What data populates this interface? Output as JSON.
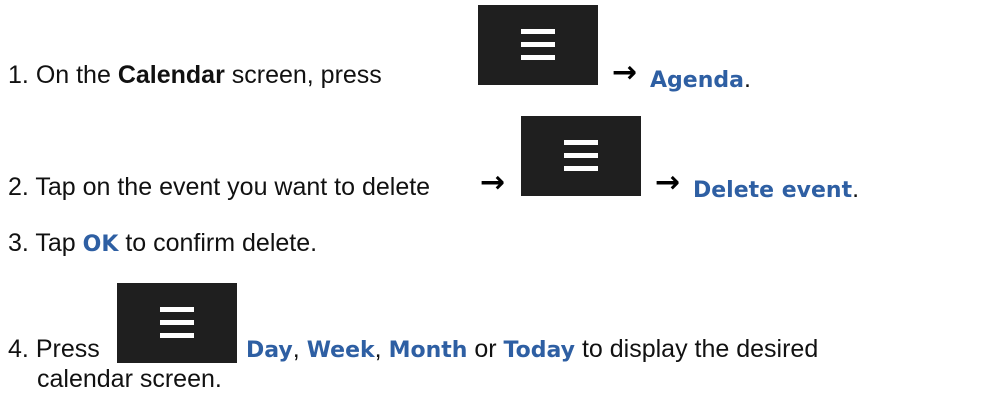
{
  "steps": [
    {
      "number": "1.",
      "prefix": "On the ",
      "bold": "Calendar",
      "middle": " screen, press",
      "arrow": "→",
      "keyword": "Agenda",
      "suffix": "."
    },
    {
      "number": "2.",
      "prefix": "Tap on the event you want to delete",
      "arrow_a": "→",
      "arrow_b": "→",
      "keyword": "Delete event",
      "suffix": "."
    },
    {
      "number": "3.",
      "prefix": "Tap ",
      "keyword": "OK",
      "suffix": " to confirm delete."
    },
    {
      "number": "4.",
      "prefix": "Press",
      "kw_day": "Day",
      "sep1": ", ",
      "kw_week": "Week",
      "sep2": ", ",
      "kw_month": "Month",
      "or": " or ",
      "kw_today": "Today",
      "suffix": " to display the desired",
      "line2": "calendar screen."
    }
  ],
  "icons": {
    "menu": "hamburger-menu-icon",
    "arrow": "right-arrow-icon"
  },
  "colors": {
    "keyword": "#2e5fa3",
    "menu_button_bg": "#1f1f1f",
    "text": "#111111"
  }
}
